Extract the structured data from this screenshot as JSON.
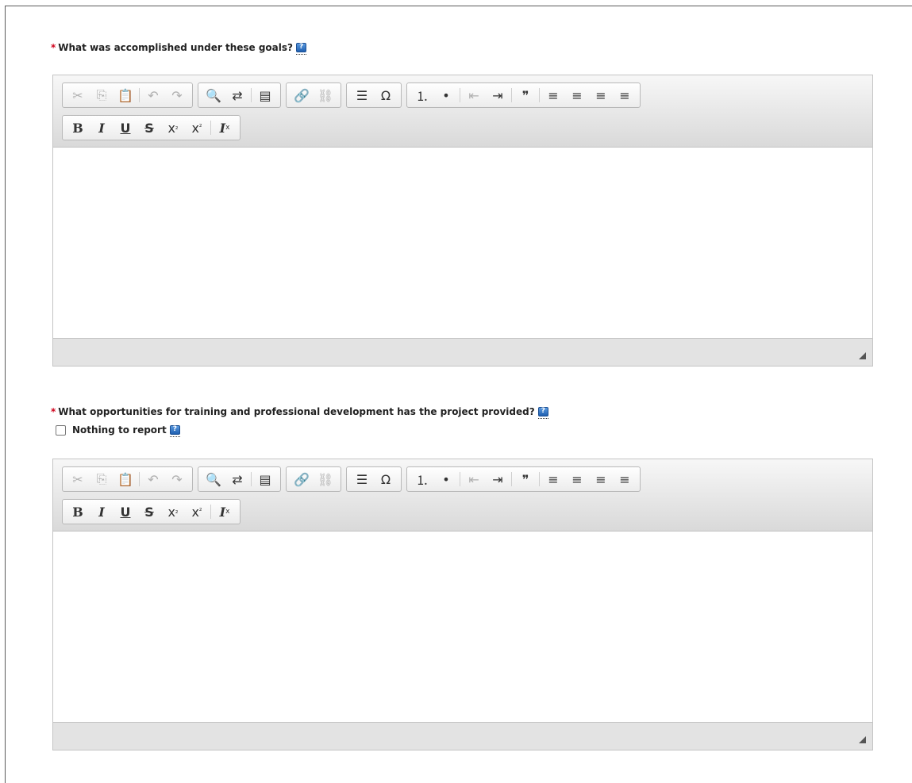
{
  "questions": [
    {
      "required_marker": "*",
      "text": "What was accomplished under these goals?"
    },
    {
      "required_marker": "*",
      "text": "What opportunities for training and professional development has the project provided?",
      "checkbox_label": "Nothing to report"
    }
  ],
  "toolbar": {
    "row1": [
      [
        {
          "icon": "cut-icon",
          "glyph": "✂",
          "enabled": false
        },
        {
          "icon": "copy-icon",
          "glyph": "⎘",
          "enabled": false
        },
        {
          "icon": "paste-text-icon",
          "glyph": "📋",
          "enabled": true
        },
        {
          "sep": true
        },
        {
          "icon": "undo-icon",
          "glyph": "↶",
          "enabled": false
        },
        {
          "icon": "redo-icon",
          "glyph": "↷",
          "enabled": false
        }
      ],
      [
        {
          "icon": "find-icon",
          "glyph": "🔍",
          "enabled": true
        },
        {
          "icon": "replace-icon",
          "glyph": "⇄",
          "enabled": true
        },
        {
          "sep": true
        },
        {
          "icon": "select-all-icon",
          "glyph": "▤",
          "enabled": true
        }
      ],
      [
        {
          "icon": "link-icon",
          "glyph": "🔗",
          "enabled": true
        },
        {
          "icon": "unlink-icon",
          "glyph": "⛓",
          "enabled": false
        }
      ],
      [
        {
          "icon": "horizontal-line-icon",
          "glyph": "☰",
          "enabled": true
        },
        {
          "icon": "special-char-icon",
          "glyph": "Ω",
          "enabled": true
        }
      ],
      [
        {
          "icon": "numbered-list-icon",
          "glyph": "⒈",
          "enabled": true
        },
        {
          "icon": "bulleted-list-icon",
          "glyph": "•",
          "enabled": true
        },
        {
          "sep": true
        },
        {
          "icon": "decrease-indent-icon",
          "glyph": "⇤",
          "enabled": false
        },
        {
          "icon": "increase-indent-icon",
          "glyph": "⇥",
          "enabled": true
        },
        {
          "sep": true
        },
        {
          "icon": "blockquote-icon",
          "glyph": "❞",
          "enabled": true
        },
        {
          "sep": true
        },
        {
          "icon": "align-left-icon",
          "glyph": "≡",
          "enabled": true
        },
        {
          "icon": "align-center-icon",
          "glyph": "≡",
          "enabled": true
        },
        {
          "icon": "align-right-icon",
          "glyph": "≡",
          "enabled": true
        },
        {
          "icon": "justify-icon",
          "glyph": "≡",
          "enabled": true
        }
      ]
    ],
    "row2": [
      [
        {
          "icon": "bold-icon",
          "text": "B",
          "style": "fmt",
          "enabled": true
        },
        {
          "icon": "italic-icon",
          "text": "I",
          "style": "it",
          "enabled": true
        },
        {
          "icon": "underline-icon",
          "text": "U",
          "style": "ul",
          "enabled": true
        },
        {
          "icon": "strikethrough-icon",
          "text": "S",
          "style": "st",
          "enabled": true
        },
        {
          "icon": "subscript-icon",
          "text": "x",
          "sub": "₂",
          "enabled": true
        },
        {
          "icon": "superscript-icon",
          "text": "x",
          "sup": "²",
          "enabled": true
        },
        {
          "sep": true
        },
        {
          "icon": "remove-format-icon",
          "text": "I",
          "sub": "x",
          "style": "it",
          "enabled": true
        }
      ]
    ]
  }
}
